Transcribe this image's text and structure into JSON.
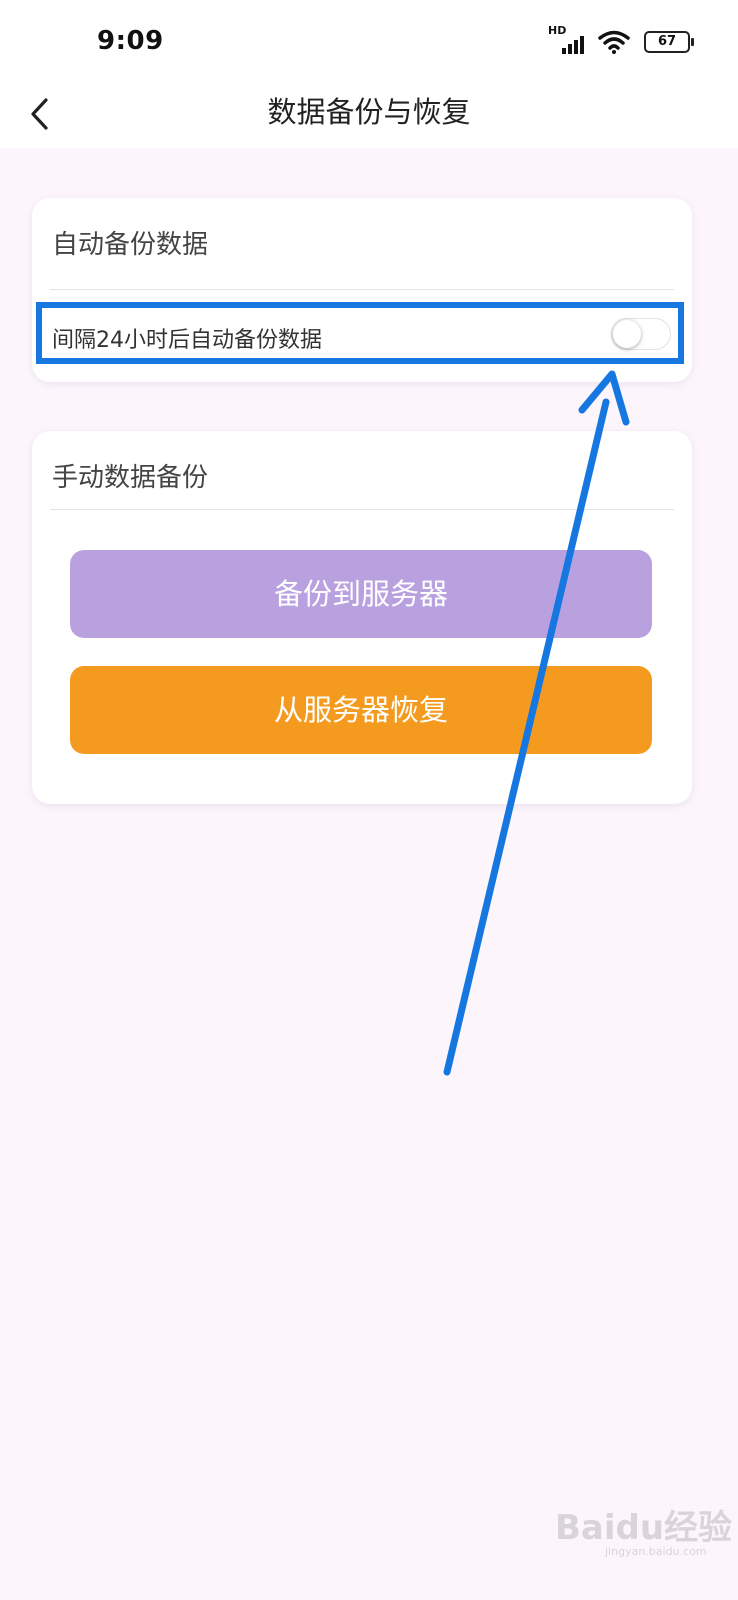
{
  "status_bar": {
    "time": "9:09",
    "network": "HD",
    "battery": "67"
  },
  "header": {
    "title": "数据备份与恢复"
  },
  "auto_backup": {
    "section_title": "自动备份数据",
    "row_label": "间隔24小时后自动备份数据",
    "toggle_on": false
  },
  "manual_backup": {
    "section_title": "手动数据备份",
    "backup_button": "备份到服务器",
    "restore_button": "从服务器恢复"
  },
  "watermark": {
    "logo": "Baidu经验",
    "url": "jingyan.baidu.com"
  },
  "colors": {
    "highlight": "#1677e0",
    "backup_button": "#b9a1e0",
    "restore_button": "#f49b1f",
    "background": "#fcf6fc"
  }
}
